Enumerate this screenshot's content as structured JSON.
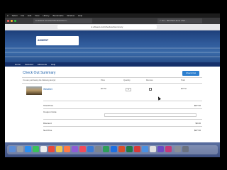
{
  "menubar": {
    "items": [
      "Safari",
      "File",
      "Edit",
      "View",
      "History",
      "Bookmarks",
      "Window",
      "Help"
    ]
  },
  "browser": {
    "tabs": [
      "● ahwest.com/sec/checkout/sum...",
      "× 1st ~ 90'Ahas'Home ahol..."
    ],
    "url": "● ahwest.com/checkout/summary"
  },
  "site": {
    "logo_text": "AHWEST",
    "nav": [
      "Home",
      "Featured",
      "All Events",
      "Help"
    ]
  },
  "cart": {
    "title": "Check Out Summary",
    "checkout_button": "Check Out",
    "intro": "You are purchasing the following item(s):",
    "columns": [
      "Price",
      "Quantity",
      "Remove",
      "Total"
    ],
    "item": {
      "name": "Weather",
      "price": "$67.50",
      "quantity": "1",
      "total": "$67.50"
    },
    "totals": [
      {
        "label": "Total Price",
        "value": "$67.50"
      },
      {
        "label": "Coupon Code",
        "value": ""
      },
      {
        "label": "Discount",
        "value": "$0.00"
      },
      {
        "label": "Net Price",
        "value": "$67.50"
      }
    ]
  },
  "colors": {
    "accent": "#2d7fcf",
    "nav": "#15306a",
    "link": "#1b5fa8"
  }
}
